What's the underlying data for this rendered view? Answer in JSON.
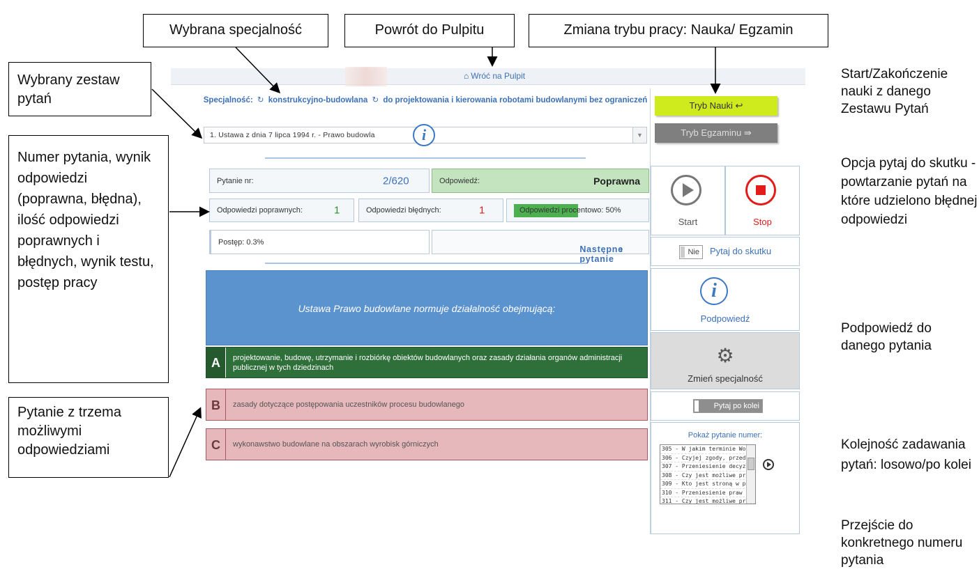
{
  "annotations": {
    "selected_specialty": "Wybrana specjalność",
    "back_to_dashboard": "Powrót do Pulpitu",
    "mode_change": "Zmiana trybu pracy: Nauka/ Egzamin",
    "selected_set": "Wybrany zestaw pytań",
    "stats_description": "Numer pytania, wynik odpowiedzi (poprawna, błędna), ilość odpowiedzi poprawnych i błędnych,  wynik testu, postęp pracy",
    "question_with_answers": "Pytanie z trzema możliwymi odpowiedziami",
    "start_stop": "Start/Zakończenie nauki z danego Zestawu Pytań",
    "ask_until_success": "Opcja pytaj do skutku - powtarzanie pytań na które udzielono błędnej odpowiedzi",
    "hint": "Podpowiedź do danego pytania",
    "order": "Kolejność zadawania pytań: losowo/po kolei",
    "goto_question": "Przejście do konkretnego numeru pytania"
  },
  "app": {
    "back_link": "Wróć na Pulpit",
    "specialty_prefix": "Specjalność:",
    "specialty_1": "konstrukcyjno-budowlana",
    "specialty_2": "do projektowania i kierowania robotami budowlanymi bez ograniczeń",
    "set_value": "1. Ustawa z dnia 7 lipca 1994 r. - Prawo budowla",
    "question_no_label": "Pytanie nr:",
    "question_no_value": "2/620",
    "answer_label": "Odpowiedź:",
    "answer_value": "Poprawna",
    "correct_label": "Odpowiedzi poprawnych:",
    "correct_value": "1",
    "wrong_label": "Odpowiedzi błędnych:",
    "wrong_value": "1",
    "percent_label": "Odpowiedzi procentowo: 50%",
    "percent_fraction": 0.5,
    "progress_label": "Postęp: 0.3%",
    "next_button": "Następne pytanie",
    "question_text": "Ustawa Prawo budowlane normuje działalność obejmującą:",
    "answers": [
      {
        "letter": "A",
        "text": "projektowanie, budowę, utrzymanie i rozbiórkę obiektów budowlanych oraz zasady działania organów administracji publicznej w tych dziedzinach"
      },
      {
        "letter": "B",
        "text": "zasady dotyczące postępowania uczestników procesu budowlanego"
      },
      {
        "letter": "C",
        "text": "wykonawstwo budowlane na obszarach wyrobisk górniczych"
      }
    ],
    "accent_correct": "#2f6f3a",
    "accent_wrong": "#e6b8bb"
  },
  "panel": {
    "learn_mode": "Tryb Nauki",
    "exam_mode": "Tryb Egzaminu",
    "start": "Start",
    "stop": "Stop",
    "toggle_value": "Nie",
    "ask_until_success": "Pytaj do skutku",
    "hint": "Podpowiedź",
    "change_specialty": "Zmień specjalność",
    "order_toggle": "Pytaj po kolei",
    "goto_title": "Pokaż pytanie numer:",
    "goto_items": [
      "305 - W jakim terminie Wo",
      "306 - Czyjej zgody, przed w",
      "307 - Przeniesienie decyzj",
      "308 - Czy jest możliwe prz",
      "309 - Kto jest stroną w pos",
      "310 - Przeniesienie praw i",
      "311 - Czy jest możliwe prz"
    ]
  }
}
